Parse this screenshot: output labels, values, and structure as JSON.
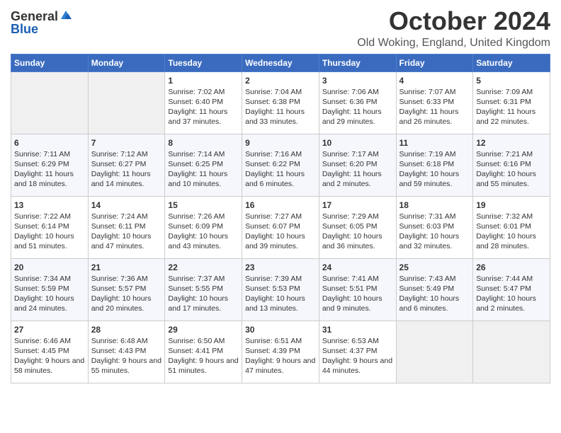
{
  "logo": {
    "general": "General",
    "blue": "Blue"
  },
  "title": "October 2024",
  "location": "Old Woking, England, United Kingdom",
  "days_of_week": [
    "Sunday",
    "Monday",
    "Tuesday",
    "Wednesday",
    "Thursday",
    "Friday",
    "Saturday"
  ],
  "weeks": [
    [
      {
        "day": "",
        "empty": true
      },
      {
        "day": "",
        "empty": true
      },
      {
        "day": "1",
        "sunrise": "Sunrise: 7:02 AM",
        "sunset": "Sunset: 6:40 PM",
        "daylight": "Daylight: 11 hours and 37 minutes."
      },
      {
        "day": "2",
        "sunrise": "Sunrise: 7:04 AM",
        "sunset": "Sunset: 6:38 PM",
        "daylight": "Daylight: 11 hours and 33 minutes."
      },
      {
        "day": "3",
        "sunrise": "Sunrise: 7:06 AM",
        "sunset": "Sunset: 6:36 PM",
        "daylight": "Daylight: 11 hours and 29 minutes."
      },
      {
        "day": "4",
        "sunrise": "Sunrise: 7:07 AM",
        "sunset": "Sunset: 6:33 PM",
        "daylight": "Daylight: 11 hours and 26 minutes."
      },
      {
        "day": "5",
        "sunrise": "Sunrise: 7:09 AM",
        "sunset": "Sunset: 6:31 PM",
        "daylight": "Daylight: 11 hours and 22 minutes."
      }
    ],
    [
      {
        "day": "6",
        "sunrise": "Sunrise: 7:11 AM",
        "sunset": "Sunset: 6:29 PM",
        "daylight": "Daylight: 11 hours and 18 minutes."
      },
      {
        "day": "7",
        "sunrise": "Sunrise: 7:12 AM",
        "sunset": "Sunset: 6:27 PM",
        "daylight": "Daylight: 11 hours and 14 minutes."
      },
      {
        "day": "8",
        "sunrise": "Sunrise: 7:14 AM",
        "sunset": "Sunset: 6:25 PM",
        "daylight": "Daylight: 11 hours and 10 minutes."
      },
      {
        "day": "9",
        "sunrise": "Sunrise: 7:16 AM",
        "sunset": "Sunset: 6:22 PM",
        "daylight": "Daylight: 11 hours and 6 minutes."
      },
      {
        "day": "10",
        "sunrise": "Sunrise: 7:17 AM",
        "sunset": "Sunset: 6:20 PM",
        "daylight": "Daylight: 11 hours and 2 minutes."
      },
      {
        "day": "11",
        "sunrise": "Sunrise: 7:19 AM",
        "sunset": "Sunset: 6:18 PM",
        "daylight": "Daylight: 10 hours and 59 minutes."
      },
      {
        "day": "12",
        "sunrise": "Sunrise: 7:21 AM",
        "sunset": "Sunset: 6:16 PM",
        "daylight": "Daylight: 10 hours and 55 minutes."
      }
    ],
    [
      {
        "day": "13",
        "sunrise": "Sunrise: 7:22 AM",
        "sunset": "Sunset: 6:14 PM",
        "daylight": "Daylight: 10 hours and 51 minutes."
      },
      {
        "day": "14",
        "sunrise": "Sunrise: 7:24 AM",
        "sunset": "Sunset: 6:11 PM",
        "daylight": "Daylight: 10 hours and 47 minutes."
      },
      {
        "day": "15",
        "sunrise": "Sunrise: 7:26 AM",
        "sunset": "Sunset: 6:09 PM",
        "daylight": "Daylight: 10 hours and 43 minutes."
      },
      {
        "day": "16",
        "sunrise": "Sunrise: 7:27 AM",
        "sunset": "Sunset: 6:07 PM",
        "daylight": "Daylight: 10 hours and 39 minutes."
      },
      {
        "day": "17",
        "sunrise": "Sunrise: 7:29 AM",
        "sunset": "Sunset: 6:05 PM",
        "daylight": "Daylight: 10 hours and 36 minutes."
      },
      {
        "day": "18",
        "sunrise": "Sunrise: 7:31 AM",
        "sunset": "Sunset: 6:03 PM",
        "daylight": "Daylight: 10 hours and 32 minutes."
      },
      {
        "day": "19",
        "sunrise": "Sunrise: 7:32 AM",
        "sunset": "Sunset: 6:01 PM",
        "daylight": "Daylight: 10 hours and 28 minutes."
      }
    ],
    [
      {
        "day": "20",
        "sunrise": "Sunrise: 7:34 AM",
        "sunset": "Sunset: 5:59 PM",
        "daylight": "Daylight: 10 hours and 24 minutes."
      },
      {
        "day": "21",
        "sunrise": "Sunrise: 7:36 AM",
        "sunset": "Sunset: 5:57 PM",
        "daylight": "Daylight: 10 hours and 20 minutes."
      },
      {
        "day": "22",
        "sunrise": "Sunrise: 7:37 AM",
        "sunset": "Sunset: 5:55 PM",
        "daylight": "Daylight: 10 hours and 17 minutes."
      },
      {
        "day": "23",
        "sunrise": "Sunrise: 7:39 AM",
        "sunset": "Sunset: 5:53 PM",
        "daylight": "Daylight: 10 hours and 13 minutes."
      },
      {
        "day": "24",
        "sunrise": "Sunrise: 7:41 AM",
        "sunset": "Sunset: 5:51 PM",
        "daylight": "Daylight: 10 hours and 9 minutes."
      },
      {
        "day": "25",
        "sunrise": "Sunrise: 7:43 AM",
        "sunset": "Sunset: 5:49 PM",
        "daylight": "Daylight: 10 hours and 6 minutes."
      },
      {
        "day": "26",
        "sunrise": "Sunrise: 7:44 AM",
        "sunset": "Sunset: 5:47 PM",
        "daylight": "Daylight: 10 hours and 2 minutes."
      }
    ],
    [
      {
        "day": "27",
        "sunrise": "Sunrise: 6:46 AM",
        "sunset": "Sunset: 4:45 PM",
        "daylight": "Daylight: 9 hours and 58 minutes."
      },
      {
        "day": "28",
        "sunrise": "Sunrise: 6:48 AM",
        "sunset": "Sunset: 4:43 PM",
        "daylight": "Daylight: 9 hours and 55 minutes."
      },
      {
        "day": "29",
        "sunrise": "Sunrise: 6:50 AM",
        "sunset": "Sunset: 4:41 PM",
        "daylight": "Daylight: 9 hours and 51 minutes."
      },
      {
        "day": "30",
        "sunrise": "Sunrise: 6:51 AM",
        "sunset": "Sunset: 4:39 PM",
        "daylight": "Daylight: 9 hours and 47 minutes."
      },
      {
        "day": "31",
        "sunrise": "Sunrise: 6:53 AM",
        "sunset": "Sunset: 4:37 PM",
        "daylight": "Daylight: 9 hours and 44 minutes."
      },
      {
        "day": "",
        "empty": true
      },
      {
        "day": "",
        "empty": true
      }
    ]
  ]
}
